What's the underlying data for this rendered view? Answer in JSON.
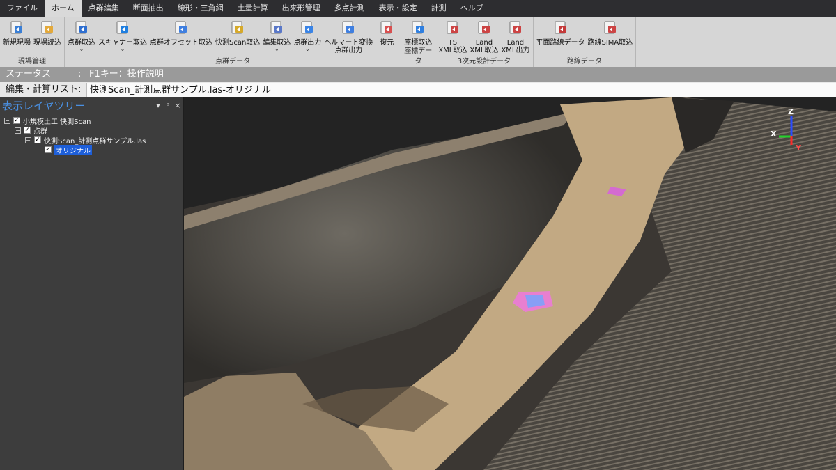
{
  "menu": [
    "ファイル",
    "ホーム",
    "点群編集",
    "断面抽出",
    "線形・三角網",
    "土量計算",
    "出来形管理",
    "多点計測",
    "表示・設定",
    "計測",
    "ヘルプ"
  ],
  "ribbon": {
    "groups": [
      {
        "label": "現場管理",
        "buttons": [
          {
            "label": "新規現場",
            "icon": "new-site-icon"
          },
          {
            "label": "現場読込",
            "icon": "folder-open-icon"
          }
        ]
      },
      {
        "label": "点群データ",
        "buttons": [
          {
            "label": "点群取込",
            "icon": "point-cloud-import-icon",
            "dropdown": true
          },
          {
            "label": "スキャナー取込",
            "icon": "scanner-import-icon",
            "dropdown": true
          },
          {
            "label": "点群オフセット取込",
            "icon": "offset-import-icon"
          },
          {
            "label": "快測Scan取込",
            "icon": "kaisoku-scan-icon"
          },
          {
            "label": "編集取込",
            "icon": "edit-import-icon",
            "dropdown": true
          },
          {
            "label": "点群出力",
            "icon": "point-cloud-export-icon",
            "dropdown": true
          },
          {
            "label": "ヘルマート変換\n点群出力",
            "icon": "helmert-export-icon"
          },
          {
            "label": "復元",
            "icon": "restore-icon"
          }
        ]
      },
      {
        "label": "座標データ",
        "buttons": [
          {
            "label": "座標取込",
            "icon": "coordinate-import-icon"
          }
        ]
      },
      {
        "label": "3次元設計データ",
        "buttons": [
          {
            "label": "TS\nXML取込",
            "icon": "ts-xml-import-icon"
          },
          {
            "label": "Land\nXML取込",
            "icon": "landxml-import-icon"
          },
          {
            "label": "Land\nXML出力",
            "icon": "landxml-export-icon"
          }
        ]
      },
      {
        "label": "路線データ",
        "buttons": [
          {
            "label": "平面路線データ",
            "icon": "plan-route-icon"
          },
          {
            "label": "路線SIMA取込",
            "icon": "sima-import-icon"
          }
        ]
      }
    ]
  },
  "status": {
    "label": "ステータス",
    "sep": ":",
    "text": "F1キー：操作説明"
  },
  "edit_list": {
    "label": "編集・計算リスト:",
    "value": "快測Scan_計測点群サンプル.las-オリジナル"
  },
  "layer_panel": {
    "title": "表示レイヤツリー",
    "pin": "ᵖ",
    "close": "×",
    "items": [
      {
        "label": "小規模土工  快測Scan",
        "level": 0,
        "toggle": "−"
      },
      {
        "label": "点群",
        "level": 1,
        "toggle": "−"
      },
      {
        "label": "快測Scan_計測点群サンプル.las",
        "level": 2,
        "toggle": "−"
      },
      {
        "label": "オリジナル",
        "level": 3,
        "selected": true
      }
    ]
  },
  "viewport": {
    "axes": {
      "z": "Z",
      "x": "X",
      "y": "Y"
    },
    "colors": {
      "z_axis": "#2b4cff",
      "x_axis": "#ff2b2b",
      "y_axis": "#23d12b"
    }
  }
}
